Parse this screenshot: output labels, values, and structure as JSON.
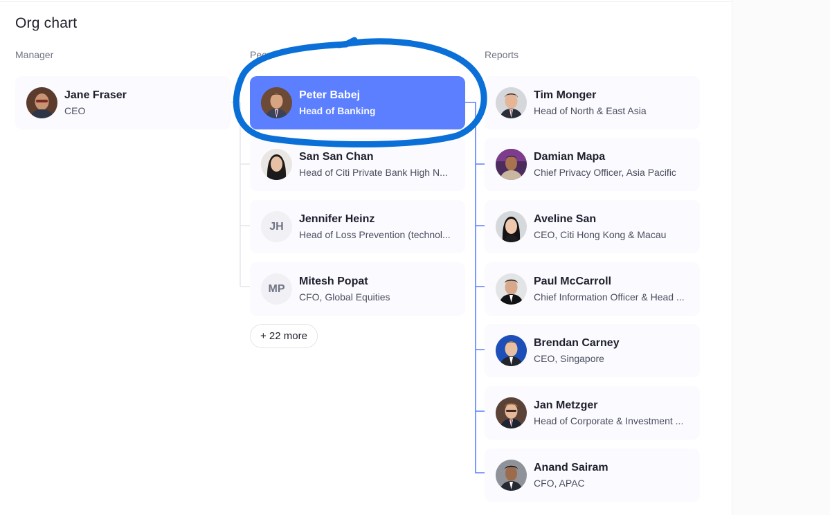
{
  "page": {
    "title": "Org chart"
  },
  "columns": {
    "manager": "Manager",
    "peers": "Peers",
    "reports": "Reports"
  },
  "manager": {
    "name": "Jane Fraser",
    "role": "CEO"
  },
  "peers": [
    {
      "name": "Peter Babej",
      "role": "Head of Banking",
      "selected": true
    },
    {
      "name": "San San Chan",
      "role": "Head of Citi Private Bank High N..."
    },
    {
      "name": "Jennifer Heinz",
      "role": "Head of Loss Prevention (technol...",
      "initials": "JH"
    },
    {
      "name": "Mitesh Popat",
      "role": "CFO, Global Equities",
      "initials": "MP"
    }
  ],
  "more_label": "+ 22 more",
  "reports": [
    {
      "name": "Tim Monger",
      "role": "Head of North & East Asia"
    },
    {
      "name": "Damian Mapa",
      "role": "Chief Privacy Officer, Asia Pacific"
    },
    {
      "name": "Aveline San",
      "role": "CEO, Citi Hong Kong & Macau"
    },
    {
      "name": "Paul McCarroll",
      "role": "Chief Information Officer & Head ..."
    },
    {
      "name": "Brendan Carney",
      "role": "CEO, Singapore"
    },
    {
      "name": "Jan Metzger",
      "role": "Head of Corporate & Investment ..."
    },
    {
      "name": "Anand Sairam",
      "role": "CFO, APAC"
    }
  ],
  "colors": {
    "accent": "#5b7fff",
    "annotation": "#0a6fd6",
    "connector_active": "#5b7fff",
    "connector": "#e3e5ea"
  }
}
